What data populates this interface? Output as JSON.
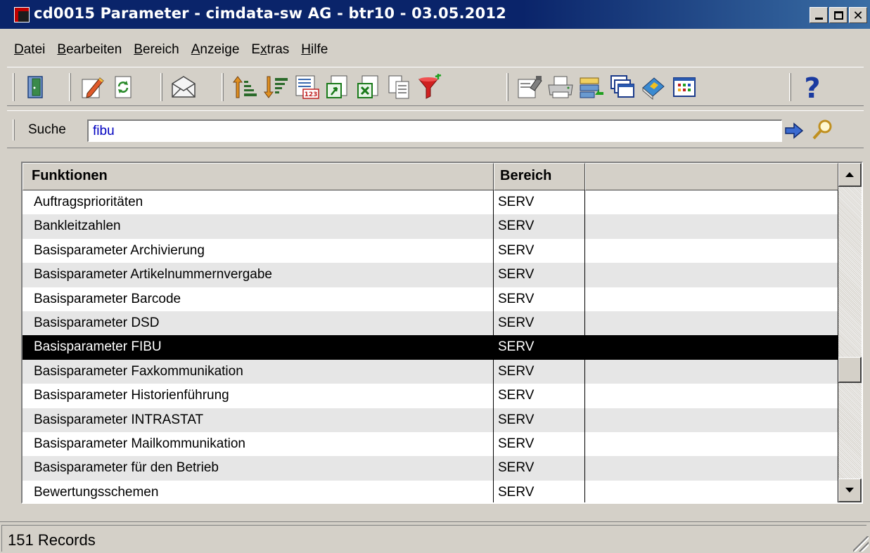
{
  "window": {
    "title": "cd0015 Parameter - cimdata-sw AG - btr10 - 03.05.2012",
    "minimize_label": "_",
    "close_label": "✕"
  },
  "menu": {
    "items": [
      {
        "label": "Datei"
      },
      {
        "label": "Bearbeiten"
      },
      {
        "label": "Bereich"
      },
      {
        "label": "Anzeige"
      },
      {
        "label": "Extras"
      },
      {
        "label": "Hilfe"
      }
    ]
  },
  "toolbar": {
    "icons": [
      "exit-door-icon",
      "edit-pencil-icon",
      "refresh-icon",
      "mail-envelope-icon",
      "sort-ascending-icon",
      "sort-descending-icon",
      "numeric-list-icon",
      "export-icon",
      "excel-export-icon",
      "copy-icon",
      "filter-funnel-icon",
      "properties-icon",
      "print-icon",
      "transfer-icon",
      "windows-icon",
      "book-icon",
      "grid-view-icon",
      "help-icon"
    ],
    "help_glyph": "?",
    "numeric_badge": "123"
  },
  "search": {
    "label": "Suche",
    "value": "fibu"
  },
  "table": {
    "headers": {
      "funktionen": "Funktionen",
      "bereich": "Bereich",
      "extra": ""
    },
    "rows": [
      {
        "funktion": "Auftragsprioritäten",
        "bereich": "SERV"
      },
      {
        "funktion": "Bankleitzahlen",
        "bereich": "SERV"
      },
      {
        "funktion": "Basisparameter Archivierung",
        "bereich": "SERV"
      },
      {
        "funktion": "Basisparameter Artikelnummernvergabe",
        "bereich": "SERV"
      },
      {
        "funktion": "Basisparameter Barcode",
        "bereich": "SERV"
      },
      {
        "funktion": "Basisparameter DSD",
        "bereich": "SERV"
      },
      {
        "funktion": "Basisparameter FIBU",
        "bereich": "SERV",
        "selected": true
      },
      {
        "funktion": "Basisparameter Faxkommunikation",
        "bereich": "SERV"
      },
      {
        "funktion": "Basisparameter Historienführung",
        "bereich": "SERV"
      },
      {
        "funktion": "Basisparameter INTRASTAT",
        "bereich": "SERV"
      },
      {
        "funktion": "Basisparameter Mailkommunikation",
        "bereich": "SERV"
      },
      {
        "funktion": "Basisparameter für den Betrieb",
        "bereich": "SERV"
      },
      {
        "funktion": "Bewertungsschemen",
        "bereich": "SERV"
      }
    ]
  },
  "status": {
    "text": "151 Records"
  },
  "colors": {
    "titlebar": "#0a246a",
    "selection": "#000000",
    "search_text": "#0000c0"
  }
}
